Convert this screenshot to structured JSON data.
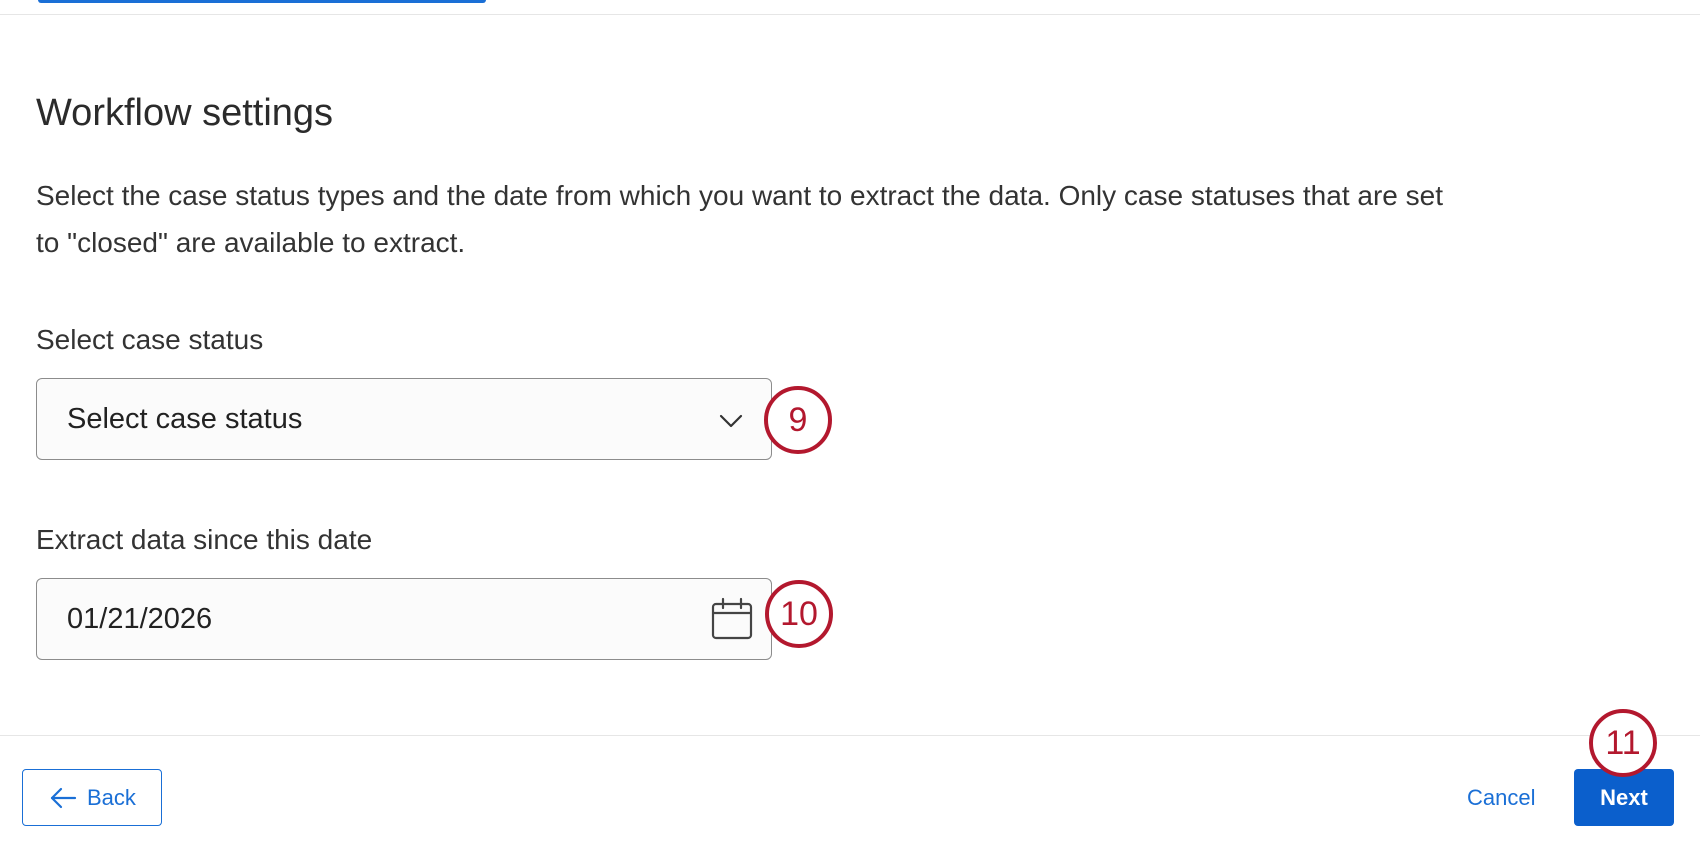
{
  "page": {
    "title": "Workflow settings",
    "description": "Select the case status types and the date from which you want to extract the data. Only case statuses that are set to \"closed\" are available to extract."
  },
  "fields": {
    "case_status": {
      "label": "Select case status",
      "value": "Select case status"
    },
    "extract_date": {
      "label": "Extract data since this date",
      "value": "01/21/2026"
    }
  },
  "callouts": {
    "step_9": "9",
    "step_10": "10",
    "step_11": "11"
  },
  "footer": {
    "back_label": "Back",
    "cancel_label": "Cancel",
    "next_label": "Next"
  },
  "colors": {
    "accent": "#1a6fd6",
    "primary_button": "#0b5fcc",
    "callout": "#b3182e"
  },
  "icons": {
    "dropdown": "chevron-down-icon",
    "date_picker": "calendar-icon",
    "back": "arrow-left-icon"
  }
}
